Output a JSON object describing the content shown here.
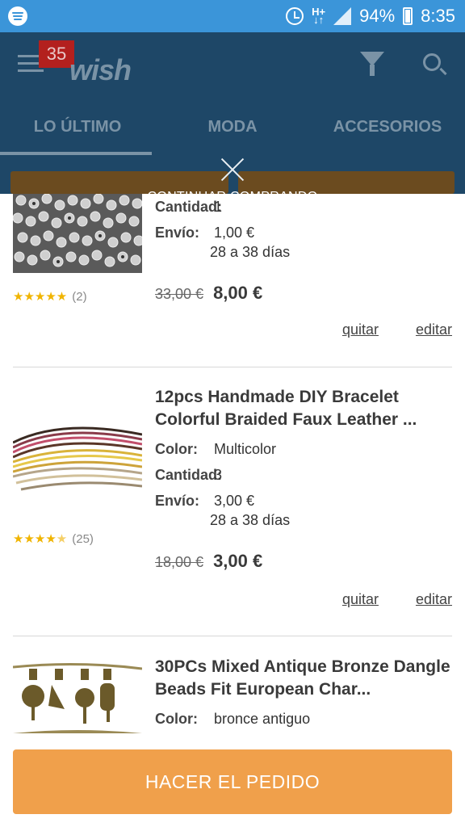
{
  "status_bar": {
    "battery": "94%",
    "time": "8:35",
    "network": "H+"
  },
  "app_header": {
    "notification_count": "35",
    "logo": "wish",
    "tabs": [
      "LO ÚLTIMO",
      "MODA",
      "ACCESORIOS"
    ]
  },
  "overlay": {
    "continue_label": "CONTINUAR COMPRANDO"
  },
  "items": [
    {
      "rating_count": "(2)",
      "stars": 5,
      "quantity_label": "Cantidad:",
      "quantity": "1",
      "shipping_label": "Envío:",
      "shipping_price": "1,00 €",
      "shipping_time": "28 a 38 días",
      "old_price": "33,00 €",
      "price": "8,00 €",
      "remove": "quitar",
      "edit": "editar"
    },
    {
      "title": "12pcs Handmade DIY Bracelet Colorful Braided Faux Leather ...",
      "rating_count": "(25)",
      "stars": 4.5,
      "color_label": "Color:",
      "color": "Multicolor",
      "quantity_label": "Cantidad:",
      "quantity": "3",
      "shipping_label": "Envío:",
      "shipping_price": "3,00 €",
      "shipping_time": "28 a 38 días",
      "old_price": "18,00 €",
      "price": "3,00 €",
      "remove": "quitar",
      "edit": "editar"
    },
    {
      "title": "30PCs Mixed Antique Bronze Dangle Beads Fit European Char...",
      "color_label": "Color:",
      "color": "bronce antiguo"
    }
  ],
  "order_button": "HACER EL PEDIDO",
  "colors": {
    "status_bar": "#3b95d9",
    "order_button": "#f0a04b",
    "stars": "#f0b400"
  }
}
